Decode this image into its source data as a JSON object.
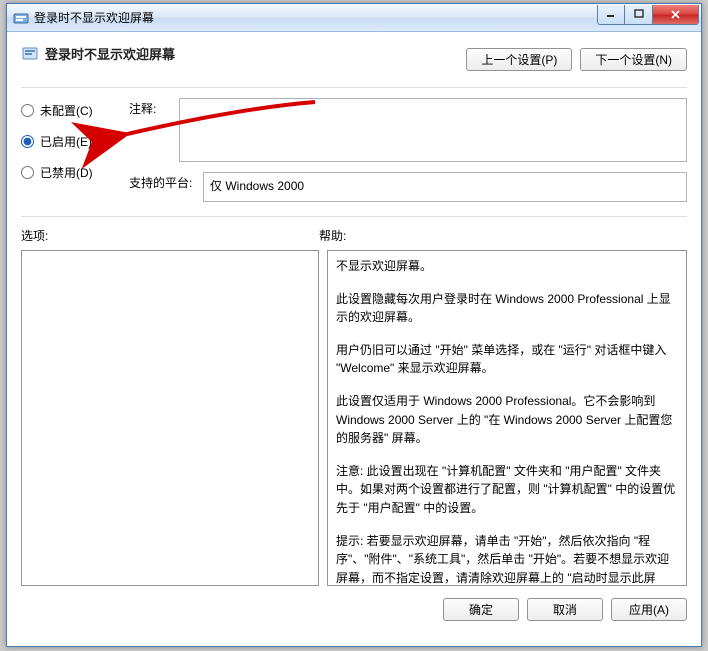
{
  "window": {
    "title": "登录时不显示欢迎屏幕"
  },
  "header": {
    "label": "登录时不显示欢迎屏幕",
    "prev": "上一个设置(P)",
    "next": "下一个设置(N)"
  },
  "radios": {
    "not_configured": "未配置(C)",
    "enabled": "已启用(E)",
    "disabled": "已禁用(D)"
  },
  "fields": {
    "comment_label": "注释:",
    "platform_label": "支持的平台:",
    "platform_value": "仅 Windows 2000"
  },
  "cols": {
    "options": "选项:",
    "help": "帮助:"
  },
  "help_text": {
    "p1": "不显示欢迎屏幕。",
    "p2": "此设置隐藏每次用户登录时在 Windows 2000 Professional 上显示的欢迎屏幕。",
    "p3": "用户仍旧可以通过 \"开始\" 菜单选择，或在 \"运行\" 对话框中键入 \"Welcome\" 来显示欢迎屏幕。",
    "p4": "此设置仅适用于 Windows 2000 Professional。它不会影响到 Windows 2000 Server 上的 \"在 Windows 2000 Server 上配置您的服务器\" 屏幕。",
    "p5": "注意: 此设置出现在 \"计算机配置\" 文件夹和 \"用户配置\" 文件夹中。如果对两个设置都进行了配置，则 \"计算机配置\" 中的设置优先于 \"用户配置\" 中的设置。",
    "p6": "提示: 若要显示欢迎屏幕，请单击 \"开始\"，然后依次指向 \"程序\"、\"附件\"、\"系统工具\"，然后单击 \"开始\"。若要不想显示欢迎屏幕，而不指定设置，请清除欢迎屏幕上的 \"启动时显示此屏"
  },
  "footer": {
    "ok": "确定",
    "cancel": "取消",
    "apply": "应用(A)"
  }
}
